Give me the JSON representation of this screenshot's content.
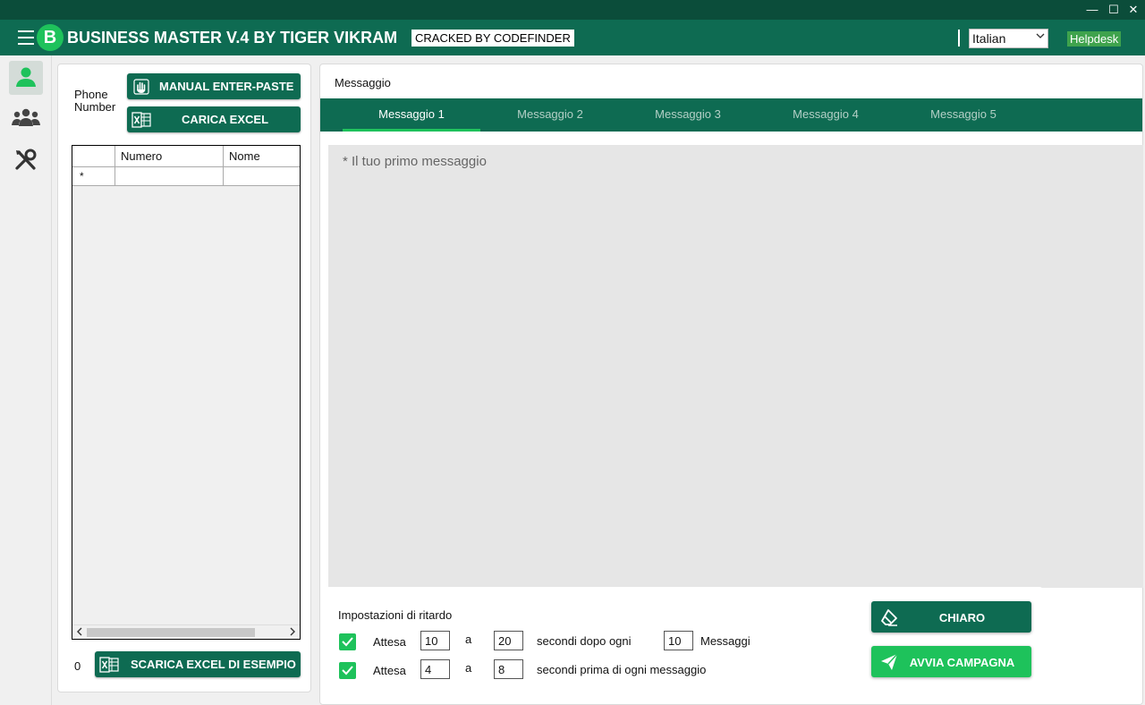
{
  "app": {
    "logo_letter": "B",
    "title": "BUSINESS MASTER V.4 BY TIGER VIKRAM",
    "badge": "CRACKED BY CODEFINDER",
    "language": "Italian",
    "helpdesk": "Helpdesk"
  },
  "window_controls": {
    "minimize": "—",
    "maximize": "☐",
    "close": "✕"
  },
  "left_panel": {
    "phone_label": "Phone Number",
    "manual_button": "MANUAL ENTER-PASTE",
    "excel_button": "CARICA EXCEL",
    "grid": {
      "columns": [
        "Numero",
        "Nome"
      ],
      "new_row_marker": "*",
      "rows": []
    },
    "count": "0",
    "sample_button": "SCARICA EXCEL DI ESEMPIO"
  },
  "message": {
    "label": "Messaggio",
    "tabs": [
      "Messaggio 1",
      "Messaggio 2",
      "Messaggio 3",
      "Messaggio 4",
      "Messaggio 5"
    ],
    "active_tab": 0,
    "placeholder": "* Il tuo primo messaggio"
  },
  "delay": {
    "title": "Impostazioni di ritardo",
    "row1": {
      "wait": "Attesa",
      "from": "10",
      "to_word": "a",
      "to": "20",
      "desc": "secondi dopo ogni",
      "count": "10",
      "unit": "Messaggi"
    },
    "row2": {
      "wait": "Attesa",
      "from": "4",
      "to_word": "a",
      "to": "8",
      "desc": "secondi prima di ogni messaggio"
    }
  },
  "buttons": {
    "clear": "CHIARO",
    "start": "AVVIA CAMPAGNA"
  },
  "colors": {
    "header": "#0e6b52",
    "titlebar": "#0b4d3a",
    "accent": "#1ec25b",
    "helpdesk": "#3fa34d"
  },
  "icons": [
    "hamburger-icon",
    "user-icon",
    "group-icon",
    "tools-icon",
    "hand-icon",
    "excel-icon",
    "eraser-icon",
    "send-icon",
    "check-icon"
  ]
}
